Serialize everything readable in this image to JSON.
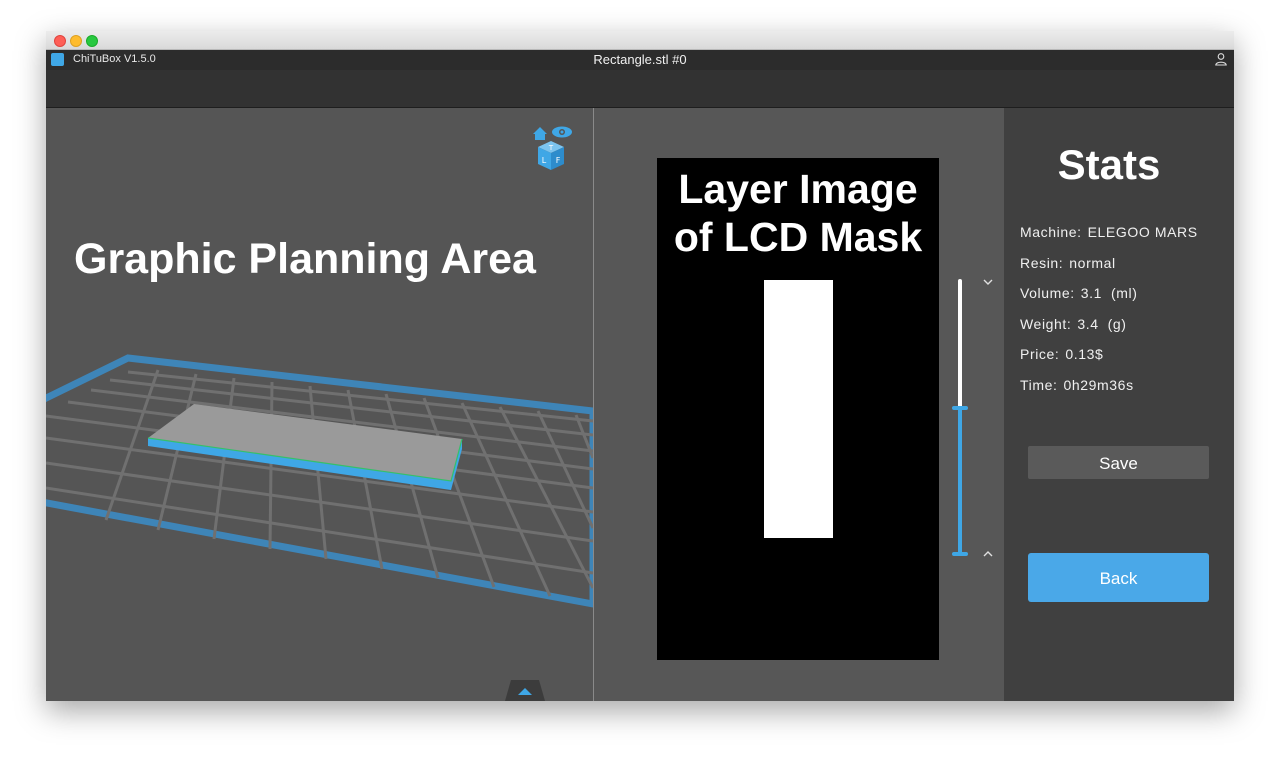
{
  "app": {
    "name": "ChiTuBox V1.5.0",
    "document_title": "Rectangle.stl #0"
  },
  "planning": {
    "label": "Graphic Planning Area"
  },
  "layer_view": {
    "label_line1": "Layer Image",
    "label_line2": "of LCD Mask"
  },
  "stats": {
    "title": "Stats",
    "rows": [
      {
        "label": "Machine:",
        "value": "ELEGOO MARS"
      },
      {
        "label": "Resin:",
        "value": "normal"
      },
      {
        "label": "Volume:",
        "value": "3.1  (ml)"
      },
      {
        "label": "Weight:",
        "value": "3.4  (g)"
      },
      {
        "label": "Price:",
        "value": "0.13$"
      },
      {
        "label": "Time:",
        "value": "0h29m36s"
      }
    ],
    "save_label": "Save",
    "back_label": "Back"
  },
  "icons": {
    "app_logo": "chitubox-logo-icon",
    "user": "user-icon",
    "view_cube": "view-cube-icon",
    "expand": "chevron-up-icon"
  },
  "colors": {
    "accent": "#4aa8e8",
    "background": "#555555",
    "panel": "#404040"
  }
}
